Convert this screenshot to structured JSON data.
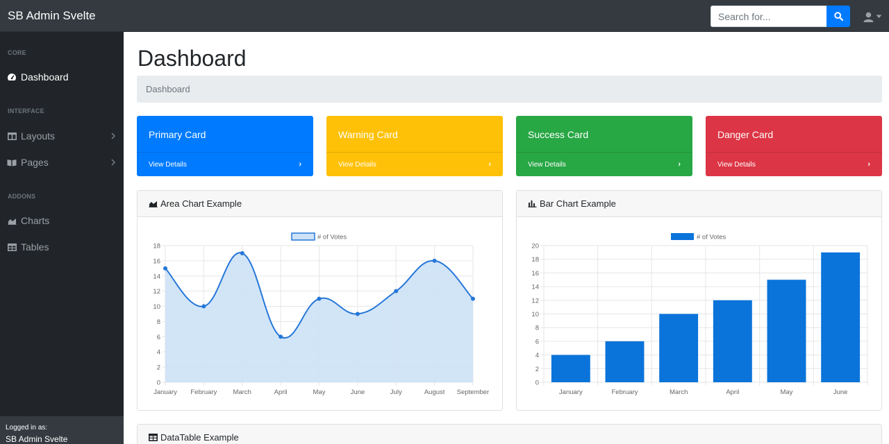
{
  "navbar": {
    "brand": "SB Admin Svelte",
    "search_placeholder": "Search for...",
    "search_icon": "search-icon",
    "user_icon": "user-icon"
  },
  "sidebar": {
    "headings": [
      "CORE",
      "INTERFACE",
      "ADDONS"
    ],
    "items": [
      {
        "label": "Dashboard",
        "icon": "tachometer-icon",
        "active": true
      },
      {
        "label": "Layouts",
        "icon": "columns-icon"
      },
      {
        "label": "Pages",
        "icon": "book-open-icon"
      },
      {
        "label": "Charts",
        "icon": "area-chart-icon"
      },
      {
        "label": "Tables",
        "icon": "table-icon"
      }
    ],
    "footer_label": "Logged in as:",
    "footer_user": "SB Admin Svelte"
  },
  "main": {
    "title": "Dashboard",
    "breadcrumb": "Dashboard",
    "cards": [
      {
        "title": "Primary Card",
        "link": "View Details",
        "color": "#007bff"
      },
      {
        "title": "Warning Card",
        "link": "View Details",
        "color": "#ffc107"
      },
      {
        "title": "Success Card",
        "link": "View Details",
        "color": "#28a745"
      },
      {
        "title": "Danger Card",
        "link": "View Details",
        "color": "#dc3545"
      }
    ],
    "area_panel_title": "Area Chart Example",
    "bar_panel_title": "Bar Chart Example",
    "table_panel_title": "DataTable Example"
  },
  "chart_data": [
    {
      "type": "area",
      "categories": [
        "January",
        "February",
        "March",
        "April",
        "May",
        "June",
        "July",
        "August",
        "September"
      ],
      "series": [
        {
          "name": "# of Votes",
          "values": [
            15,
            10,
            17,
            6,
            11,
            9,
            12,
            16,
            11
          ]
        }
      ],
      "ylim": [
        0,
        18
      ],
      "yticks": [
        0,
        2,
        4,
        6,
        8,
        10,
        12,
        14,
        16,
        18
      ],
      "legend": "top",
      "grid": true,
      "color": "#2577d9",
      "fill": "#cde2f6"
    },
    {
      "type": "bar",
      "categories": [
        "January",
        "February",
        "March",
        "April",
        "May",
        "June"
      ],
      "series": [
        {
          "name": "# of Votes",
          "values": [
            4,
            6,
            10,
            12,
            15,
            19
          ]
        }
      ],
      "ylim": [
        0,
        20
      ],
      "yticks": [
        0,
        2,
        4,
        6,
        8,
        10,
        12,
        14,
        16,
        18,
        20
      ],
      "legend": "top",
      "grid": true,
      "color": "#0a74da"
    }
  ]
}
